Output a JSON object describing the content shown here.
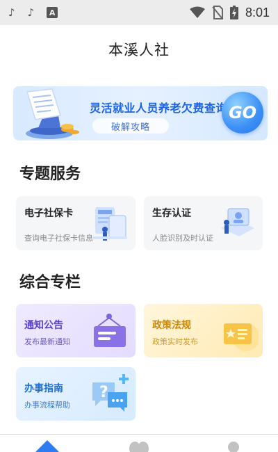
{
  "status_bar": {
    "left_icons": [
      "tiktok-icon",
      "tiktok-icon",
      "app-a-icon"
    ],
    "a_glyph": "A",
    "right_icons": [
      "wifi-icon",
      "no-sim-icon",
      "battery-icon"
    ],
    "time": "8:01"
  },
  "header": {
    "title": "本溪人社"
  },
  "banner": {
    "title": "灵活就业人员养老欠费查询",
    "pill_label": "破解攻略",
    "go_label": "GO"
  },
  "sections": {
    "special_services": {
      "title": "专题服务",
      "cards": [
        {
          "title": "电子社保卡",
          "subtitle": "查询电子社保卡信息"
        },
        {
          "title": "生存认证",
          "subtitle": "人脸识别及时认证"
        }
      ]
    },
    "columns": {
      "title": "综合专栏",
      "cards": [
        {
          "title": "通知公告",
          "subtitle": "发布最新通知"
        },
        {
          "title": "政策法规",
          "subtitle": "政策实时发布"
        },
        {
          "title": "办事指南",
          "subtitle": "办事流程帮助"
        }
      ]
    }
  },
  "colors": {
    "banner_title": "#1b62e6",
    "notice": "#5a43c9",
    "policy": "#c9880a",
    "guide": "#1f6fd1",
    "nav_active": "#2f7cf0"
  }
}
